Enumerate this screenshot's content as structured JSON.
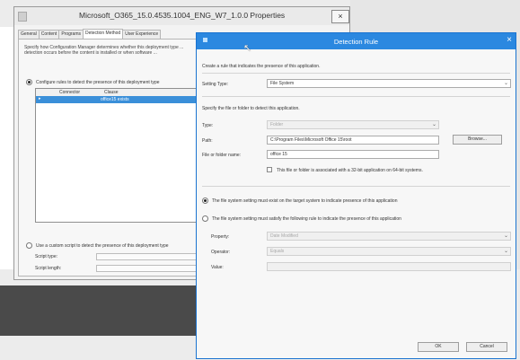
{
  "properties_window": {
    "title": "Microsoft_O365_15.0.4535.1004_ENG_W7_1.0.0 Properties",
    "close": "×",
    "tabs": [
      "General",
      "Content",
      "Programs",
      "Detection Method",
      "User Experience"
    ],
    "description": "Specify how Configuration Manager determines whether this deployment type ... detection occurs before the content is installed or when software ...",
    "configure_rules_label": "Configure rules to detect the presence of this deployment type",
    "grid_headers": {
      "connector": "Connector",
      "clause": "Clause"
    },
    "grid_row": {
      "marker": "▸",
      "clause": "office15 exists"
    },
    "custom_script_label": "Use a custom script to detect the presence of this deployment type",
    "script_type_label": "Script type:",
    "script_length_label": "Script length:"
  },
  "detection_rule": {
    "title": "Detection Rule",
    "close": "×",
    "intro": "Create a rule that indicates the presence of this application.",
    "setting_type_label": "Setting Type:",
    "setting_type_value": "File System",
    "specify_label": "Specify the file or folder to detect this application.",
    "type_label": "Type:",
    "type_value": "Folder",
    "path_label": "Path:",
    "path_value": "C:\\Program Files\\Microsoft Office 15\\root",
    "browse_label": "Browse...",
    "name_label": "File or folder name:",
    "name_value": "office 15",
    "bitness_label": "This file or folder is associated with a 32-bit application on 64-bit systems.",
    "must_exist_label": "The file system setting must exist on the target system to indicate presence of this application",
    "must_satisfy_label": "The file system setting must satisfy the following rule to indicate the presence of this application",
    "property_label": "Property:",
    "property_value": "Date Modified",
    "operator_label": "Operator:",
    "operator_value": "Equals",
    "value_label": "Value:",
    "ok_label": "OK",
    "cancel_label": "Cancel"
  },
  "colors": {
    "title_bar": "#2b88e0",
    "selection": "#3a8fd9",
    "background_panel": "#4a4a4a"
  }
}
